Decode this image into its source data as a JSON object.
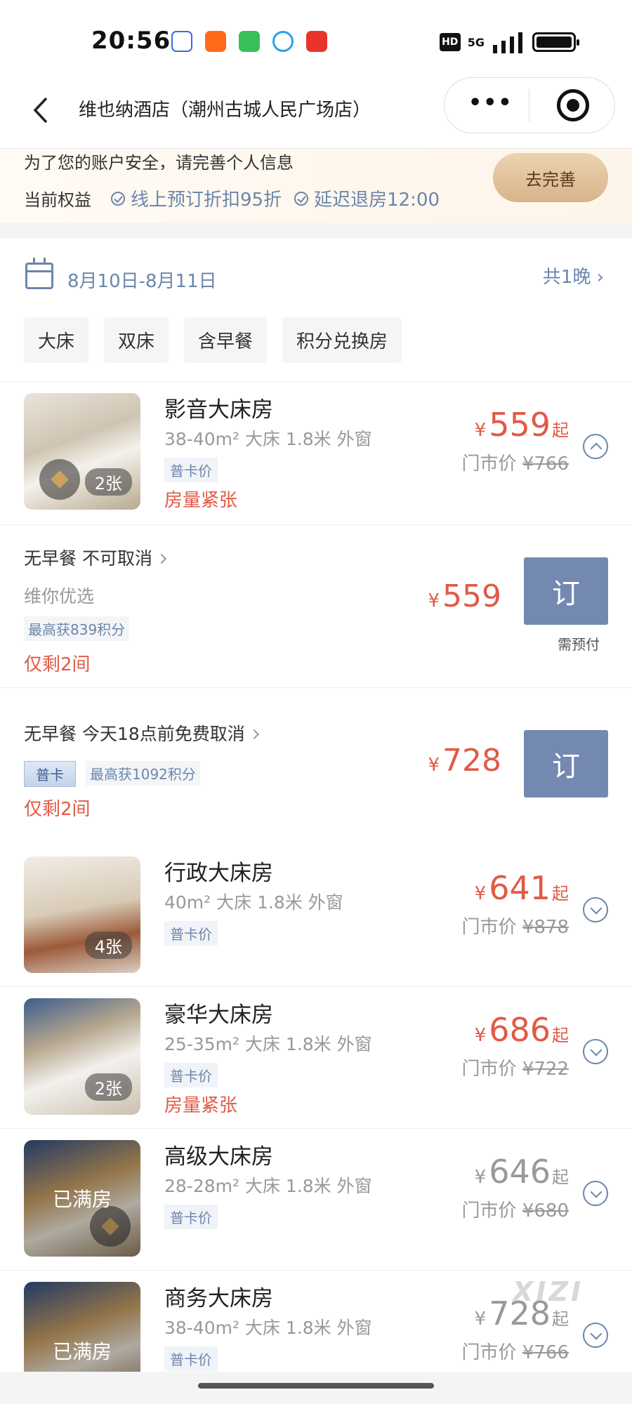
{
  "status_bar": {
    "time": "20:56",
    "hd": "HD",
    "network": "5G"
  },
  "nav": {
    "title": "维也纳酒店（潮州古城人民广场店）"
  },
  "member": {
    "message": "为了您的账户安全，请完善个人信息",
    "benefit_label": "当前权益",
    "benefits": [
      "线上预订折扣95折",
      "延迟退房12:00"
    ],
    "complete_button": "去完善"
  },
  "stay": {
    "dates": "8月10日-8月11日",
    "nights": "共1晚"
  },
  "filters": [
    "大床",
    "双床",
    "含早餐",
    "积分兑换房"
  ],
  "rooms": [
    {
      "name": "影音大床房",
      "spec": "38-40m²  大床 1.8米  外窗",
      "tag": "普卡价",
      "tight": "房量紧张",
      "photos": "2张",
      "price": "559",
      "qi": "起",
      "orig_label": "门市价",
      "orig_price": "¥766",
      "sold_out": "",
      "expanded": true
    },
    {
      "name": "行政大床房",
      "spec": "40m²  大床 1.8米  外窗",
      "tag": "普卡价",
      "tight": "",
      "photos": "4张",
      "price": "641",
      "qi": "起",
      "orig_label": "门市价",
      "orig_price": "¥878",
      "sold_out": ""
    },
    {
      "name": "豪华大床房",
      "spec": "25-35m²  大床 1.8米  外窗",
      "tag": "普卡价",
      "tight": "房量紧张",
      "photos": "2张",
      "price": "686",
      "qi": "起",
      "orig_label": "门市价",
      "orig_price": "¥722",
      "sold_out": ""
    },
    {
      "name": "高级大床房",
      "spec": "28-28m²  大床 1.8米  外窗",
      "tag": "普卡价",
      "tight": "",
      "photos": "",
      "price": "646",
      "qi": "起",
      "orig_label": "门市价",
      "orig_price": "¥680",
      "sold_out": "已满房"
    },
    {
      "name": "商务大床房",
      "spec": "38-40m²  大床 1.8米  外窗",
      "tag": "普卡价",
      "tight": "",
      "photos": "",
      "price": "728",
      "qi": "起",
      "orig_label": "门市价",
      "orig_price": "¥766",
      "sold_out": "已满房"
    }
  ],
  "plans": [
    {
      "title": "无早餐 不可取消",
      "sub": "维你优选",
      "points": "最高获839积分",
      "left": "仅剩2间",
      "price": "559",
      "book": "订",
      "prepay": "需预付"
    },
    {
      "title": "无早餐 今天18点前免费取消",
      "card": "普卡",
      "points": "最高获1092积分",
      "left": "仅剩2间",
      "price": "728",
      "book": "订"
    }
  ],
  "currency": "¥",
  "watermark": "XIZI",
  "colors": {
    "accent_blue": "#6b86aa",
    "price_red": "#e15a45",
    "book_button": "#7489b0"
  }
}
